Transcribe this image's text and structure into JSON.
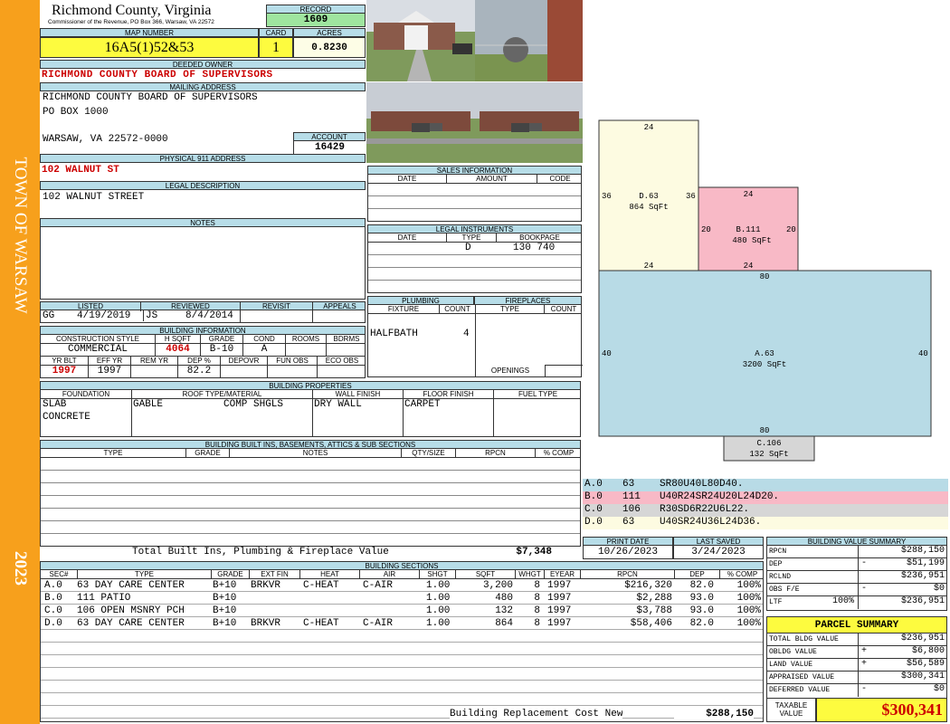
{
  "side": {
    "town": "TOWN OF WARSAW",
    "year": "2023",
    "color": "#f7a01c"
  },
  "header": {
    "county": "Richmond County, Virginia",
    "commissioner": "Commissioner of the Revenue, PO Box 366, Warsaw, VA 22572",
    "record_label": "RECORD",
    "record": "1609",
    "map_label": "MAP NUMBER",
    "map_number": "16A5(1)52&53",
    "card_label": "CARD",
    "card": "1",
    "acres_label": "ACRES",
    "acres": "0.8230"
  },
  "owner": {
    "label": "DEEDED OWNER",
    "name": "RICHMOND COUNTY BOARD OF SUPERVISORS",
    "mail_label": "MAILING ADDRESS",
    "mail1": "RICHMOND COUNTY BOARD OF SUPERVISORS",
    "mail2": "PO BOX  1000",
    "mail3": "WARSAW, VA 22572-0000",
    "account_label": "ACCOUNT",
    "account": "16429",
    "phys_label": "PHYSICAL 911 ADDRESS",
    "phys": "102 WALNUT ST",
    "legal_label": "LEGAL DESCRIPTION",
    "legal": "102 WALNUT STREET",
    "notes_label": "NOTES"
  },
  "listed": {
    "listed_label": "LISTED",
    "reviewed_label": "REVIEWED",
    "revisit_label": "REVISIT",
    "appeals_label": "APPEALS",
    "lister": "GG",
    "listed_date": "4/19/2019",
    "reviewer": "JS",
    "reviewed_date": "8/4/2014"
  },
  "building": {
    "label": "BUILDING INFORMATION",
    "h": [
      "CONSTRUCTION STYLE",
      "H SQFT",
      "GRADE",
      "COND",
      "ROOMS",
      "BDRMS"
    ],
    "style": "COMMERCIAL",
    "hsqft": "4064",
    "grade": "B-10",
    "cond": "A",
    "h2": [
      "YR BLT",
      "EFF YR",
      "REM YR",
      "DEP %",
      "DEPOVR",
      "FUN OBS",
      "ECO OBS"
    ],
    "yrblt": "1997",
    "effyr": "1997",
    "dep": "82.2"
  },
  "sales": {
    "label": "SALES INFORMATION",
    "h": [
      "DATE",
      "AMOUNT",
      "CODE"
    ]
  },
  "legal_instr": {
    "label": "LEGAL INSTRUMENTS",
    "h": [
      "DATE",
      "TYPE",
      "BOOKPAGE"
    ],
    "type": "D",
    "bookpage": "130 740"
  },
  "plumbing": {
    "label": "PLUMBING",
    "h": [
      "FIXTURE",
      "COUNT"
    ],
    "fixture": "HALFBATH",
    "count": "4",
    "fp_label": "FIREPLACES",
    "fp_h": [
      "TYPE",
      "COUNT"
    ],
    "openings": "OPENINGS"
  },
  "props": {
    "label": "BUILDING PROPERTIES",
    "h": [
      "FOUNDATION",
      "ROOF TYPE/MATERIAL",
      "WALL FINISH",
      "FLOOR FINISH",
      "FUEL TYPE"
    ],
    "found1": "SLAB",
    "found2": "CONCRETE",
    "roof1": "GABLE",
    "roof2": "COMP SHGLS",
    "wall": "DRY WALL",
    "floor": "CARPET"
  },
  "builtins": {
    "label": "BUILDING BUILT INS, BASEMENTS, ATTICS & SUB SECTIONS",
    "h": [
      "TYPE",
      "GRADE",
      "NOTES",
      "QTY/SIZE",
      "RPCN",
      "% COMP"
    ],
    "total_label": "Total Built Ins, Plumbing & Fireplace Value",
    "total": "$7,348"
  },
  "dates": {
    "print_label": "PRINT DATE",
    "print": "10/26/2023",
    "saved_label": "LAST SAVED",
    "saved": "3/24/2023"
  },
  "sections": {
    "label": "BUILDING SECTIONS",
    "h": [
      "SEC#",
      "TYPE",
      "GRADE",
      "EXT FIN",
      "HEAT",
      "AIR",
      "SHGT",
      "SQFT",
      "WHGT",
      "EYEAR",
      "RPCN",
      "DEP",
      "% COMP"
    ],
    "rows": [
      {
        "sec": "A.0",
        "type": "63 DAY CARE CENTER",
        "grade": "B+10",
        "ext": "BRKVR",
        "heat": "C-HEAT",
        "air": "C-AIR",
        "shgt": "1.00",
        "sqft": "3,200",
        "whgt": "8",
        "eyear": "1997",
        "rpcn": "$216,320",
        "dep": "82.0",
        "comp": "100%"
      },
      {
        "sec": "B.0",
        "type": "111 PATIO",
        "grade": "B+10",
        "ext": "",
        "heat": "",
        "air": "",
        "shgt": "1.00",
        "sqft": "480",
        "whgt": "8",
        "eyear": "1997",
        "rpcn": "$2,288",
        "dep": "93.0",
        "comp": "100%"
      },
      {
        "sec": "C.0",
        "type": "106 OPEN MSNRY PCH",
        "grade": "B+10",
        "ext": "",
        "heat": "",
        "air": "",
        "shgt": "1.00",
        "sqft": "132",
        "whgt": "8",
        "eyear": "1997",
        "rpcn": "$3,788",
        "dep": "93.0",
        "comp": "100%"
      },
      {
        "sec": "D.0",
        "type": "63 DAY CARE CENTER",
        "grade": "B+10",
        "ext": "BRKVR",
        "heat": "C-HEAT",
        "air": "C-AIR",
        "shgt": "1.00",
        "sqft": "864",
        "whgt": "8",
        "eyear": "1997",
        "rpcn": "$58,406",
        "dep": "82.0",
        "comp": "100%"
      }
    ],
    "brcn_label": "Building Replacement Cost New",
    "brcn": "$288,150"
  },
  "sketch": {
    "A": {
      "label": "A.63",
      "area": "3200 SqFt",
      "top": "80",
      "bottom": "80",
      "left": "40",
      "right": "40",
      "color": "#b8dbe6"
    },
    "B": {
      "label": "B.111",
      "area": "480 SqFt",
      "top": "24",
      "bottom": "24",
      "left": "20",
      "right": "20",
      "color": "#f8b9c6"
    },
    "C": {
      "label": "C.106",
      "area": "132 SqFt",
      "color": "#d6d6d6"
    },
    "D": {
      "label": "D.63",
      "area": "864 SqFt",
      "top": "24",
      "bottom": "24",
      "left": "36",
      "right": "36",
      "color": "#fdfbe1"
    }
  },
  "legend": [
    {
      "sec": "A.0",
      "code": "63",
      "path": "SR80U40L80D40.",
      "color": "#b8dbe6"
    },
    {
      "sec": "B.0",
      "code": "111",
      "path": "U40R24SR24U20L24D20.",
      "color": "#f8b9c6"
    },
    {
      "sec": "C.0",
      "code": "106",
      "path": "R30SD6R22U6L22.",
      "color": "#d6d6d6"
    },
    {
      "sec": "D.0",
      "code": "63",
      "path": "U40SR24U36L24D36.",
      "color": "#fdfbe1"
    }
  ],
  "bvs": {
    "label": "BUILDING VALUE SUMMARY",
    "rpcn_l": "RPCN",
    "rpcn": "$288,150",
    "dep_l": "DEP",
    "dep_s": "-",
    "dep": "$51,199",
    "rclnd_l": "RCLND",
    "rclnd": "$236,951",
    "obs_l": "OBS F/E",
    "obs_s": "-",
    "obs": "$0",
    "ltf_l": "LTF",
    "ltf_p": "100%",
    "ltf": "$236,951"
  },
  "parcel": {
    "label": "PARCEL SUMMARY",
    "tbv_l": "TOTAL BLDG VALUE",
    "tbv": "$236,951",
    "obv_l": "OBLDG VALUE",
    "obv_s": "+",
    "obv": "$6,800",
    "lv_l": "LAND VALUE",
    "lv_s": "+",
    "lv": "$56,589",
    "av_l": "APPRAISED VALUE",
    "av": "$300,341",
    "dv_l": "DEFERRED VALUE",
    "dv_s": "-",
    "dv": "$0",
    "tax_l1": "TAXABLE",
    "tax_l2": "VALUE",
    "tax": "$300,341"
  }
}
